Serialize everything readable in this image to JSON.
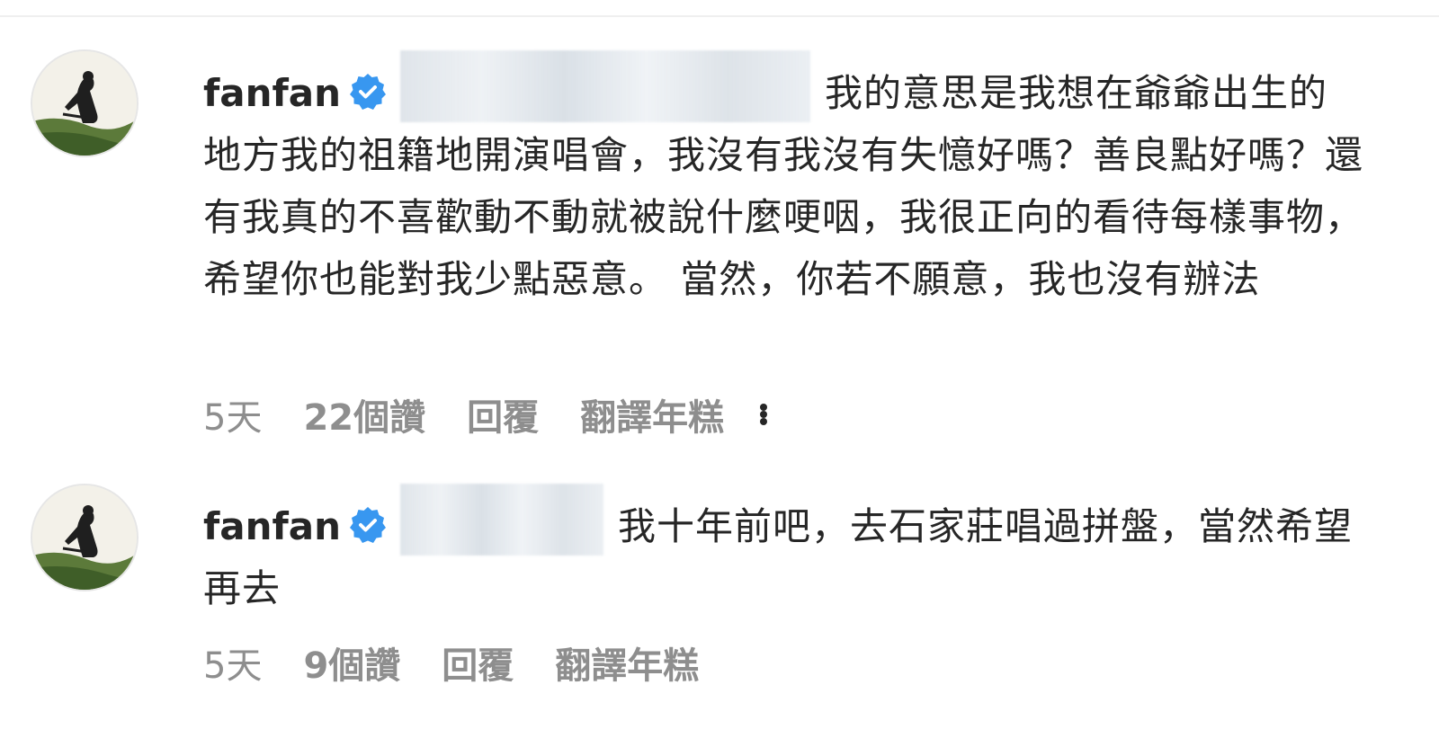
{
  "comments": [
    {
      "username": "fanfan",
      "text": "我的意思是我想在爺爺出生的地方我的祖籍地開演唱會，我沒有我沒有失憶好嗎？善良點好嗎？還有我真的不喜歡動不動就被說什麼哽咽，我很正向的看待每樣事物，希望你也能對我少點惡意。 當然，你若不願意，我也沒有辦法",
      "time": "5天",
      "likes": "22個讚",
      "reply": "回覆",
      "translate": "翻譯年糕"
    },
    {
      "username": "fanfan",
      "text": "我十年前吧，去石家莊唱過拼盤，當然希望再去",
      "time": "5天",
      "likes": "9個讚",
      "reply": "回覆",
      "translate": "翻譯年糕"
    }
  ],
  "icons": {
    "verified": "verified-badge-icon",
    "more": "more-options-icon"
  },
  "colors": {
    "text": "#262626",
    "secondary": "#8e8e8e",
    "verified": "#3897f0"
  }
}
